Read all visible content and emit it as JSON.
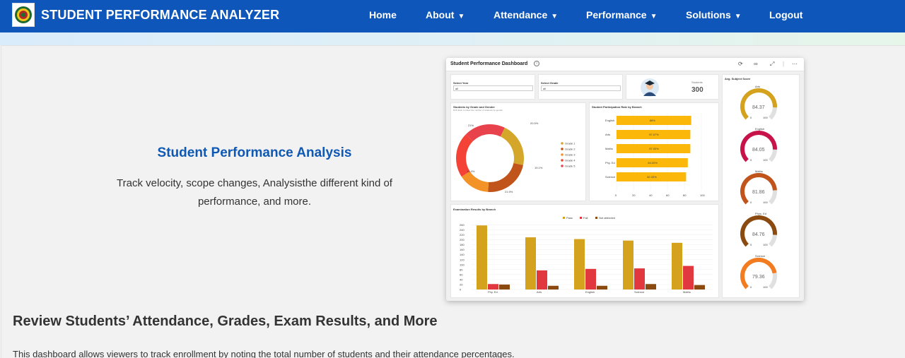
{
  "nav": {
    "brand": "STUDENT PERFORMANCE ANALYZER",
    "items": [
      {
        "label": "Home",
        "caret": ""
      },
      {
        "label": "About",
        "caret": "▼"
      },
      {
        "label": "Attendance",
        "caret": "▼"
      },
      {
        "label": "Performance",
        "caret": "▼"
      },
      {
        "label": "Solutions",
        "caret": "▼"
      },
      {
        "label": "Logout",
        "caret": ""
      }
    ]
  },
  "hero": {
    "title": "Student Performance Analysis",
    "description": "Track velocity, scope changes, Analysisthe different kind of performance, and more."
  },
  "section": {
    "title": "Review Students’ Attendance, Grades, Exam Results, and More",
    "text": "This dashboard allows viewers to track enrollment by noting the total number of students and their attendance percentages."
  },
  "dashboard": {
    "title": "Student Performance Dashboard",
    "select_year_label": "Select Year",
    "select_year_value": "all",
    "select_grade_label": "Select Grade",
    "select_grade_value": "all",
    "students_label": "Students",
    "students_value": "300",
    "gauges_title": "Avg. Subject Score",
    "donut": {
      "title": "Students by Grade and Gender",
      "subtitle": "Drill down to show the number of students by gender",
      "labels": [
        "20.5%",
        "19.1%",
        "21.9%",
        "14.4%",
        "21%"
      ],
      "legend": [
        "Grade 1",
        "Grade 2",
        "Grade 3",
        "Grade 4",
        "Grade 5"
      ]
    },
    "participation": {
      "title": "Student Participation Rate by Branch",
      "axis": [
        "0",
        "20",
        "40",
        "60",
        "80",
        "100"
      ]
    },
    "exam": {
      "title": "Examination Results by Branch",
      "legend": [
        "Pass",
        "Fail",
        "Not attended"
      ],
      "yaxis": [
        "0",
        "20",
        "40",
        "60",
        "80",
        "100",
        "120",
        "140",
        "160",
        "180",
        "200",
        "220",
        "240",
        "260"
      ]
    }
  },
  "chart_data": [
    {
      "type": "pie",
      "title": "Students by Grade and Gender",
      "categories": [
        "Grade 1",
        "Grade 2",
        "Grade 3",
        "Grade 4",
        "Grade 5"
      ],
      "values": [
        20.5,
        21.9,
        14.4,
        21,
        19.1
      ],
      "colors": [
        "#d4a62a",
        "#c0541b",
        "#f39226",
        "#f44336",
        "#e8434d"
      ]
    },
    {
      "type": "bar",
      "title": "Student Participation Rate by Branch",
      "categories": [
        "English",
        "Arts",
        "Maths",
        "Phy. Ed",
        "Science"
      ],
      "values": [
        88,
        87,
        87,
        84,
        82
      ],
      "bar_labels": [
        "88%",
        "87.67%",
        "87.00%",
        "84.00%",
        "82.33%"
      ],
      "xlim": [
        0,
        100
      ]
    },
    {
      "type": "bar",
      "title": "Examination Results by Branch",
      "categories": [
        "Phy. Ed",
        "Arts",
        "English",
        "Science",
        "Maths"
      ],
      "series": [
        {
          "name": "Pass",
          "values": [
            258,
            210,
            203,
            197,
            188
          ],
          "color": "#d4a21c"
        },
        {
          "name": "Fail",
          "values": [
            22,
            77,
            83,
            85,
            95
          ],
          "color": "#e0383e"
        },
        {
          "name": "Not attended",
          "values": [
            20,
            15,
            15,
            22,
            18
          ],
          "color": "#8a4a10"
        }
      ],
      "ylim": [
        0,
        270
      ]
    },
    {
      "type": "gauge",
      "title": "Avg. Subject Score",
      "categories": [
        "Arts",
        "English",
        "Maths",
        "Phys. Ed",
        "Science"
      ],
      "values": [
        84.37,
        84.05,
        81.86,
        84.76,
        79.36
      ],
      "range": [
        0,
        100
      ],
      "colors": [
        "#d4a21c",
        "#c8124a",
        "#c0541b",
        "#8a4a10",
        "#f47c20"
      ]
    }
  ]
}
